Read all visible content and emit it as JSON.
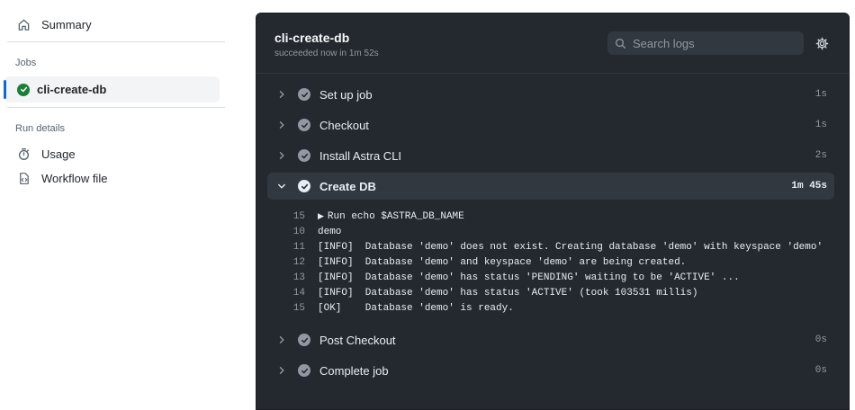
{
  "sidebar": {
    "summary_label": "Summary",
    "jobs_heading": "Jobs",
    "job_label": "cli-create-db",
    "run_details_heading": "Run details",
    "usage_label": "Usage",
    "workflow_label": "Workflow file"
  },
  "panel": {
    "title": "cli-create-db",
    "subtitle": "succeeded now in 1m 52s",
    "search_placeholder": "Search logs",
    "steps": [
      {
        "name": "Set up job",
        "duration": "1s"
      },
      {
        "name": "Checkout",
        "duration": "1s"
      },
      {
        "name": "Install Astra CLI",
        "duration": "2s"
      },
      {
        "name": "Create DB",
        "duration": "1m 45s"
      },
      {
        "name": "Post Checkout",
        "duration": "0s"
      },
      {
        "name": "Complete job",
        "duration": "0s"
      }
    ],
    "log_lines": [
      {
        "num": "15",
        "text": "Run echo $ASTRA_DB_NAME"
      },
      {
        "num": "10",
        "text": "demo"
      },
      {
        "num": "11",
        "text": "[INFO]  Database 'demo' does not exist. Creating database 'demo' with keyspace 'demo'"
      },
      {
        "num": "12",
        "text": "[INFO]  Database 'demo' and keyspace 'demo' are being created."
      },
      {
        "num": "13",
        "text": "[INFO]  Database 'demo' has status 'PENDING' waiting to be 'ACTIVE' ..."
      },
      {
        "num": "14",
        "text": "[INFO]  Database 'demo' has status 'ACTIVE' (took 103531 millis)"
      },
      {
        "num": "15",
        "text": "[OK]    Database 'demo' is ready."
      }
    ]
  },
  "colors": {
    "accent": "#0969da",
    "success": "#1a7f37",
    "panel_bg": "#24292f"
  },
  "icons": {
    "summary": "home-icon",
    "job_status": "check-circle-icon",
    "usage": "stopwatch-icon",
    "workflow": "file-code-icon",
    "search": "search-icon",
    "settings": "gear-icon",
    "step_collapsed": "chevron-right-icon",
    "step_expanded": "chevron-down-icon",
    "step_status": "check-circle-icon"
  }
}
